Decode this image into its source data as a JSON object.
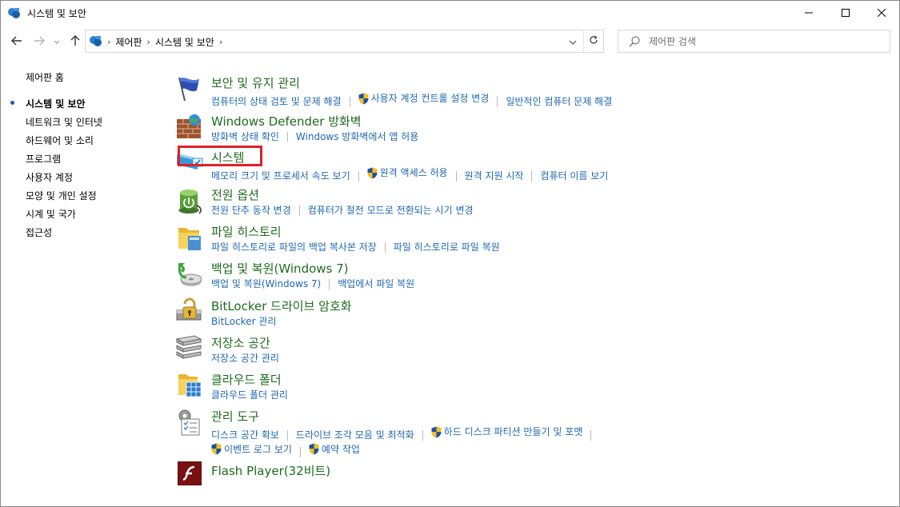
{
  "window": {
    "title": "시스템 및 보안",
    "controls": {
      "minimize": "minimize",
      "maximize": "maximize",
      "close": "close"
    }
  },
  "address": {
    "crumbs": [
      "제어판",
      "시스템 및 보안"
    ]
  },
  "search": {
    "placeholder": "제어판 검색"
  },
  "sidebar": {
    "items": [
      {
        "label": "제어판 홈",
        "current": false
      },
      {
        "label": "시스템 및 보안",
        "current": true
      },
      {
        "label": "네트워크 및 인터넷",
        "current": false
      },
      {
        "label": "하드웨어 및 소리",
        "current": false
      },
      {
        "label": "프로그램",
        "current": false
      },
      {
        "label": "사용자 계정",
        "current": false
      },
      {
        "label": "모양 및 개인 설정",
        "current": false
      },
      {
        "label": "시계 및 국가",
        "current": false
      },
      {
        "label": "접근성",
        "current": false
      }
    ]
  },
  "sections": [
    {
      "title": "보안 및 유지 관리",
      "icon": "flag-icon",
      "links": [
        "컴퓨터의 상태 검토 및 문제 해결",
        "사용자 계정 컨트롤 설정 변경",
        "일반적인 컴퓨터 문제 해결"
      ]
    },
    {
      "title": "Windows Defender 방화벽",
      "icon": "firewall-icon",
      "links": [
        "방화벽 상태 확인",
        "Windows 방화벽에서 앱 허용"
      ]
    },
    {
      "title": "시스템",
      "icon": "system-icon",
      "links": [
        "메모리 크기 및 프로세서 속도 보기",
        "원격 액세스 허용",
        "원격 지원 시작",
        "컴퓨터 이름 보기"
      ]
    },
    {
      "title": "전원 옵션",
      "icon": "power-icon",
      "links": [
        "전원 단추 동작 변경",
        "컴퓨터가 절전 모드로 전환되는 시기 변경"
      ]
    },
    {
      "title": "파일 히스토리",
      "icon": "file-history-icon",
      "links": [
        "파일 히스토리로 파일의 백업 복사본 저장",
        "파일 히스토리로 파일 복원"
      ]
    },
    {
      "title": "백업 및 복원(Windows 7)",
      "icon": "backup-icon",
      "links": [
        "백업 및 복원(Windows 7)",
        "백업에서 파일 복원"
      ]
    },
    {
      "title": "BitLocker 드라이브 암호화",
      "icon": "bitlocker-icon",
      "links": [
        "BitLocker 관리"
      ]
    },
    {
      "title": "저장소 공간",
      "icon": "storage-icon",
      "links": [
        "저장소 공간 관리"
      ]
    },
    {
      "title": "클라우드 폴더",
      "icon": "cloud-folder-icon",
      "links": [
        "클라우드 폴더 관리"
      ]
    },
    {
      "title": "관리 도구",
      "icon": "admin-tools-icon",
      "links": [
        "디스크 공간 확보",
        "드라이브 조각 모음 및 최적화",
        "하드 디스크 파티션 만들기 및 포맷",
        "이벤트 로그 보기",
        "예약 작업"
      ]
    },
    {
      "title": "Flash Player(32비트)",
      "icon": "flash-icon",
      "links": []
    }
  ],
  "colors": {
    "title_green": "#1e6b1e",
    "link_blue": "#1f68b3",
    "highlight_red": "#e0202a"
  }
}
